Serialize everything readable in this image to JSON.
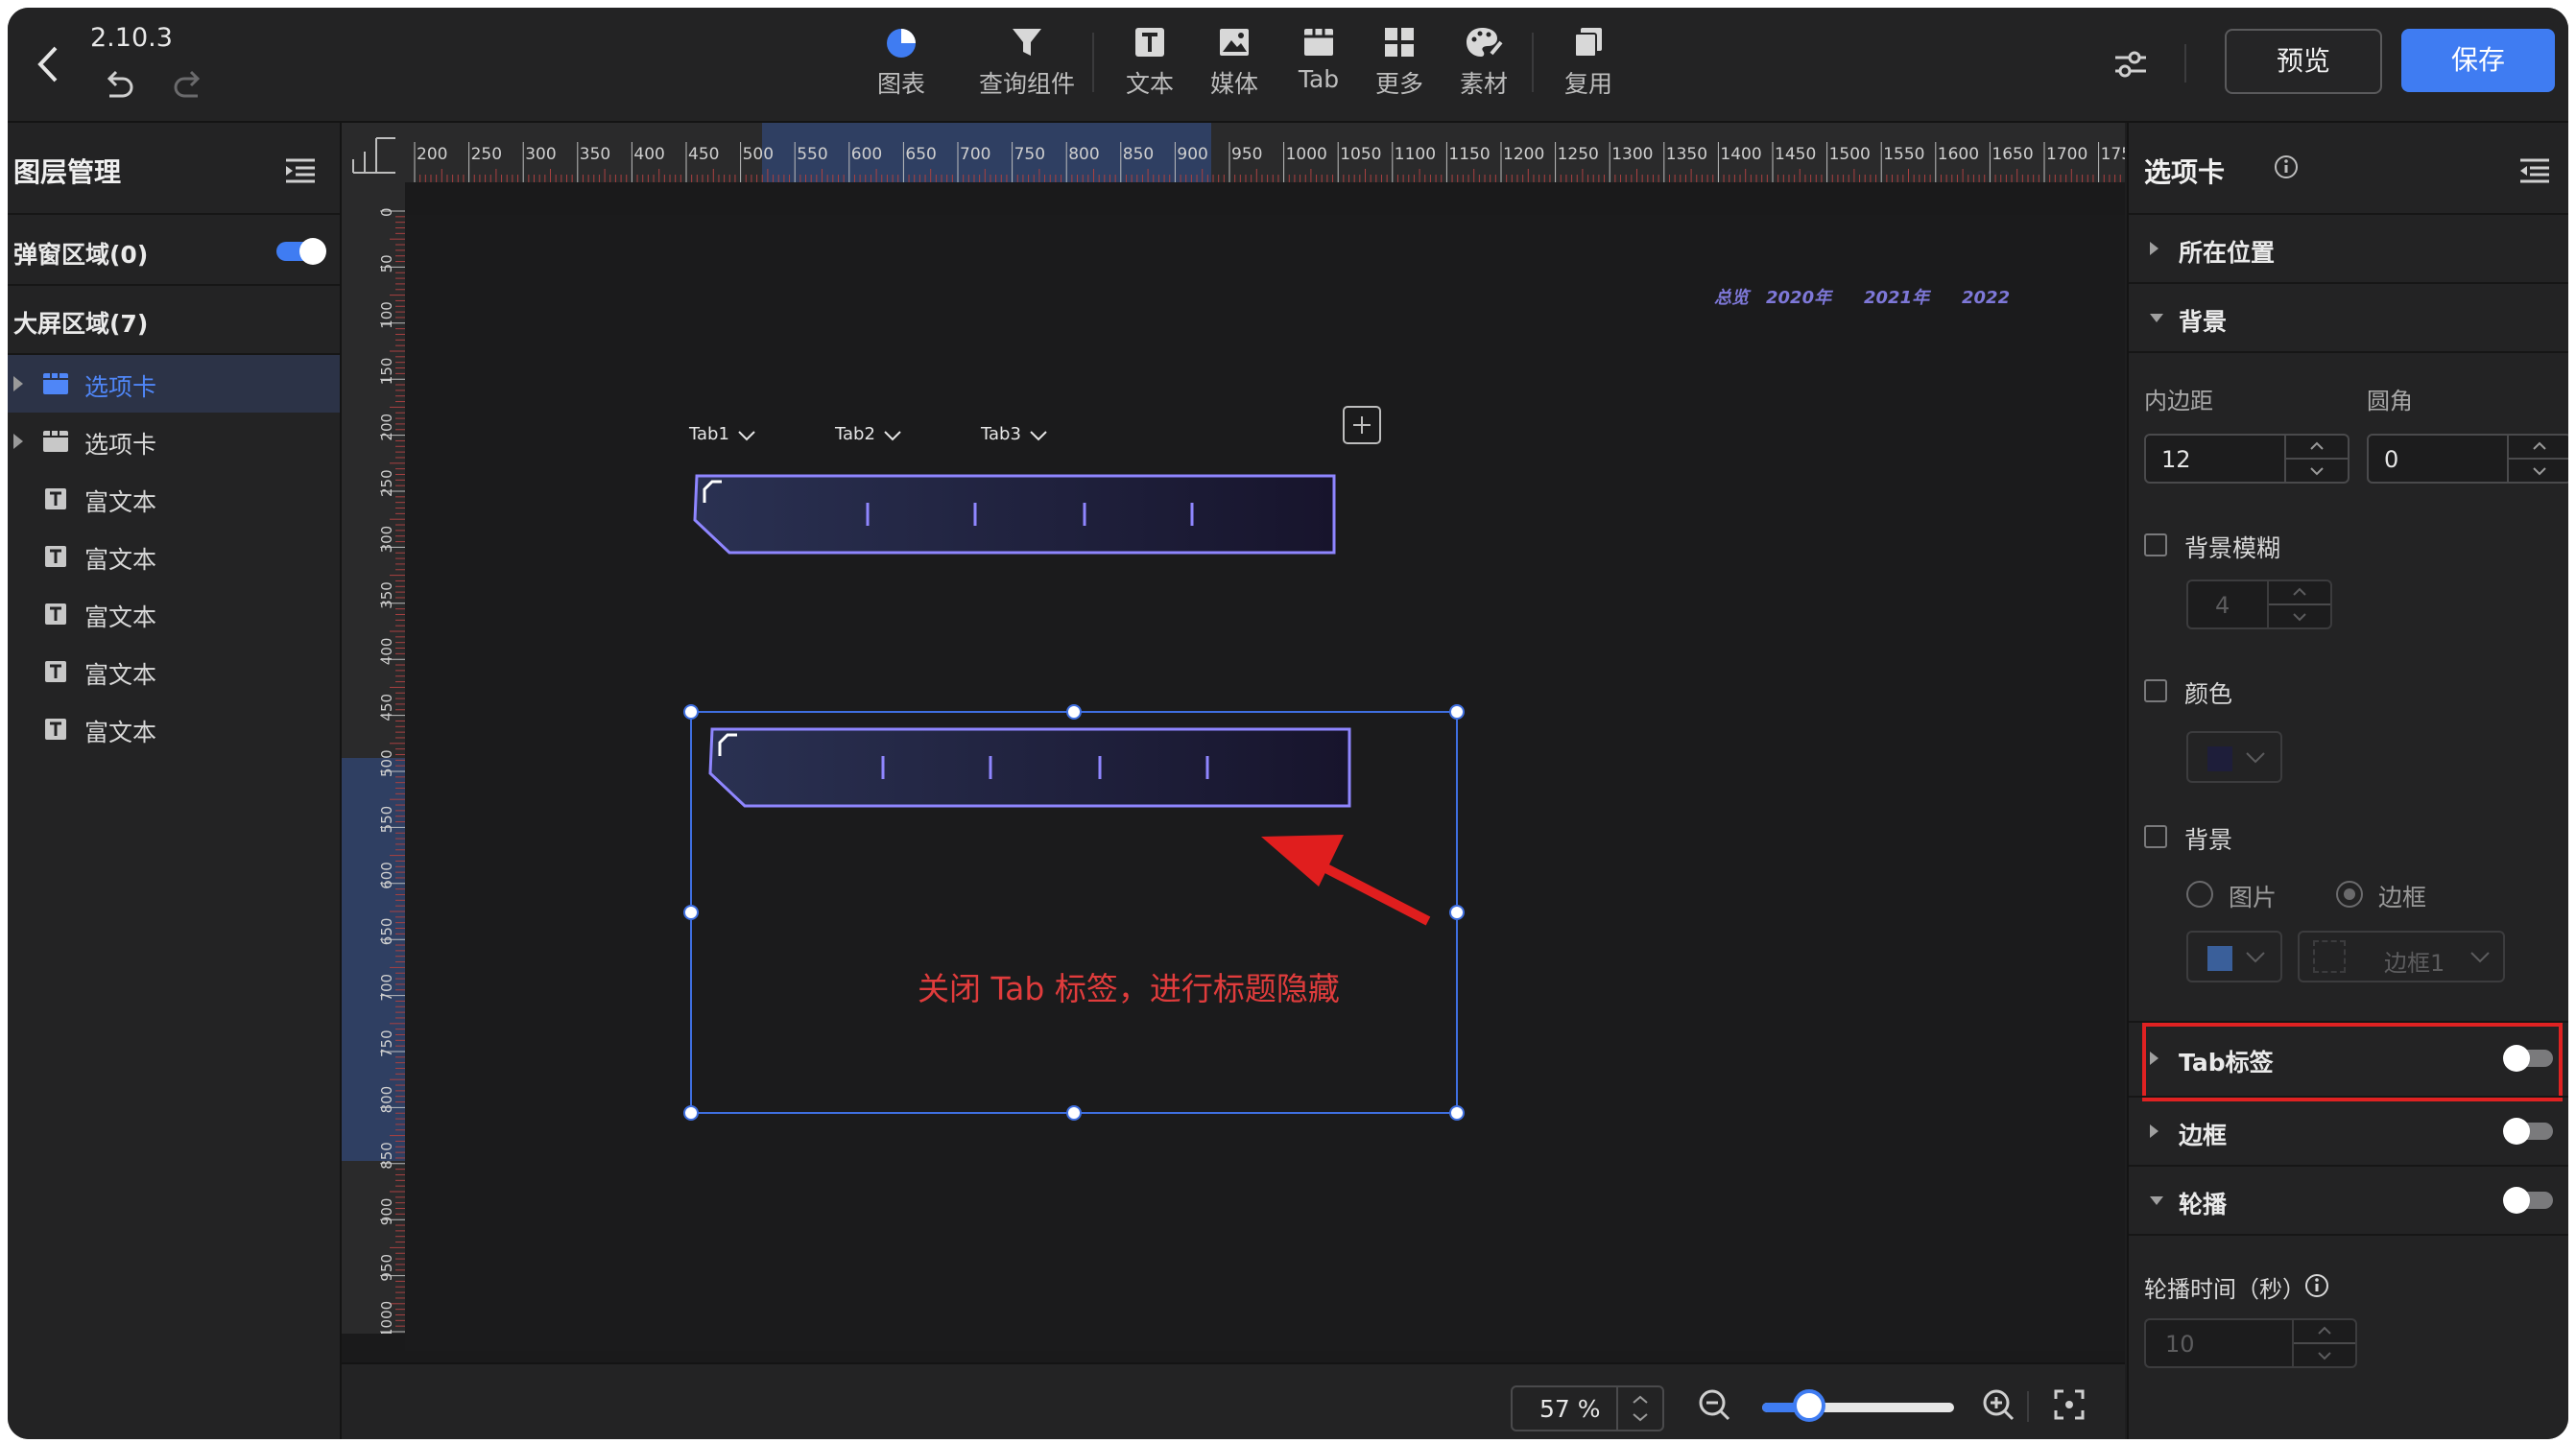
{
  "header": {
    "version": "2.10.3",
    "tools": [
      {
        "label": "图表",
        "icon": "chart-pie-icon"
      },
      {
        "label": "查询组件",
        "icon": "filter-icon"
      },
      {
        "label": "文本",
        "icon": "text-icon"
      },
      {
        "label": "媒体",
        "icon": "image-icon"
      },
      {
        "label": "Tab",
        "icon": "tab-icon"
      },
      {
        "label": "更多",
        "icon": "grid-icon"
      },
      {
        "label": "素材",
        "icon": "palette-icon"
      },
      {
        "label": "复用",
        "icon": "copy-icon"
      }
    ],
    "preview_label": "预览",
    "save_label": "保存"
  },
  "left_panel": {
    "title": "图层管理",
    "popup_area": "弹窗区域(0)",
    "screen_area": "大屏区域(7)",
    "layers": [
      {
        "label": "选项卡",
        "type": "tab",
        "selected": true
      },
      {
        "label": "选项卡",
        "type": "tab",
        "selected": false
      },
      {
        "label": "富文本",
        "type": "text",
        "selected": false
      },
      {
        "label": "富文本",
        "type": "text",
        "selected": false
      },
      {
        "label": "富文本",
        "type": "text",
        "selected": false
      },
      {
        "label": "富文本",
        "type": "text",
        "selected": false
      },
      {
        "label": "富文本",
        "type": "text",
        "selected": false
      }
    ]
  },
  "canvas": {
    "ruler_h_ticks": [
      "200",
      "250",
      "300",
      "350",
      "400",
      "450",
      "500",
      "550",
      "600",
      "650",
      "700",
      "750",
      "800",
      "850",
      "900",
      "950",
      "1000",
      "1050",
      "1100",
      "1150",
      "1200",
      "1250",
      "1300",
      "1350",
      "1400",
      "1450",
      "1500",
      "1550",
      "1600",
      "1650",
      "1700",
      "175"
    ],
    "ruler_v_ticks": [
      "0",
      "50",
      "100",
      "150",
      "200",
      "250",
      "300",
      "350",
      "400",
      "450",
      "500",
      "550",
      "600",
      "650",
      "700",
      "750",
      "800",
      "850",
      "900",
      "950",
      "1000"
    ],
    "top_tabs": [
      "总览",
      "2020年",
      "2021年",
      "2022"
    ],
    "tab_headers": [
      "Tab1",
      "Tab2",
      "Tab3"
    ],
    "annotation": "关闭 Tab 标签，进行标题隐藏",
    "zoom_value": "57 %"
  },
  "right_panel": {
    "title": "选项卡",
    "sections": {
      "position": "所在位置",
      "background": "背景",
      "tab_label": "Tab标签",
      "border": "边框",
      "carousel": "轮播"
    },
    "padding_label": "内边距",
    "padding_value": "12",
    "radius_label": "圆角",
    "radius_value": "0",
    "bg_blur_label": "背景模糊",
    "bg_blur_value": "4",
    "color_label": "颜色",
    "bg_label": "背景",
    "image_option": "图片",
    "border_option": "边框",
    "border_select": "边框1",
    "carousel_time_label": "轮播时间（秒）",
    "carousel_time_value": "10"
  },
  "colors": {
    "accent": "#3f7cf2",
    "highlight": "#e02222",
    "annotation": "#e03c3c"
  }
}
